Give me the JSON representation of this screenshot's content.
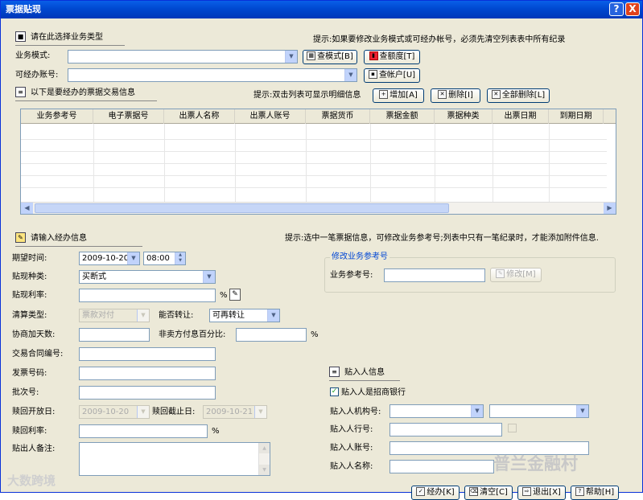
{
  "window": {
    "title": "票据贴现",
    "help": "?",
    "close": "X"
  },
  "section1": {
    "title": "请在此选择业务类型",
    "hint": "提示:如果要修改业务模式或可经办帐号，必须先清空列表表中所有纪录"
  },
  "mode": {
    "label": "业务模式:",
    "value": "",
    "btn_view_mode": "查模式[B]",
    "btn_view_quota": "查额度[T]"
  },
  "account": {
    "label": "可经办账号:",
    "value": "",
    "btn_view_account": "查帐户[U]"
  },
  "section2": {
    "title": "以下是要经办的票据交易信息",
    "hint": "提示:双击列表可显示明细信息",
    "btn_add": "增加[A]",
    "btn_delete": "删除[I]",
    "btn_delete_all": "全部删除[L]"
  },
  "grid": {
    "columns": [
      "业务参考号",
      "电子票据号",
      "出票人名称",
      "出票人账号",
      "票据货币",
      "票据金额",
      "票据种类",
      "出票日期",
      "到期日期",
      ""
    ]
  },
  "section3": {
    "title": "请输入经办信息",
    "hint": "提示:选中一笔票据信息，可修改业务参考号;列表中只有一笔纪录时，才能添加附件信息."
  },
  "form": {
    "expected_time_label": "期望时间:",
    "expected_date": "2009-10-20",
    "expected_hour": "08:00",
    "discount_type_label": "贴现种类:",
    "discount_type": "买断式",
    "discount_rate_label": "贴现利率:",
    "discount_rate": "",
    "percent": "%",
    "settle_type_label": "清算类型:",
    "settle_type": "票款对付",
    "transfer_label": "能否转让:",
    "transfer": "可再转让",
    "extra_days_label": "协商加天数:",
    "extra_days": "",
    "payer_pct_label": "非卖方付息百分比:",
    "payer_pct": "",
    "contract_label": "交易合同编号:",
    "contract": "",
    "invoice_label": "发票号码:",
    "invoice": "",
    "batch_label": "批次号:",
    "batch": "",
    "redeem_open_label": "赎回开放日:",
    "redeem_open": "2009-10-20",
    "redeem_end_label": "赎回截止日:",
    "redeem_end": "2009-10-21",
    "redeem_rate_label": "赎回利率:",
    "redeem_rate": "",
    "remark_label": "贴出人备注:",
    "remark": ""
  },
  "edit_ref": {
    "title": "修改业务参考号",
    "label": "业务参考号:",
    "value": "",
    "btn": "修改[M]"
  },
  "discountee": {
    "title": "贴入人信息",
    "is_cmb_label": "贴入人是招商银行",
    "is_cmb": true,
    "org_label": "贴入人机构号:",
    "bank_label": "贴入人行号:",
    "account_label": "贴入人账号:",
    "name_label": "贴入人名称:"
  },
  "bottom": {
    "btn_submit": "经办[K]",
    "btn_clear": "清空[C]",
    "btn_exit": "退出[X]",
    "btn_help": "帮助[H]"
  },
  "watermarks": {
    "left": "大数跨境",
    "right": "普兰金融村"
  }
}
